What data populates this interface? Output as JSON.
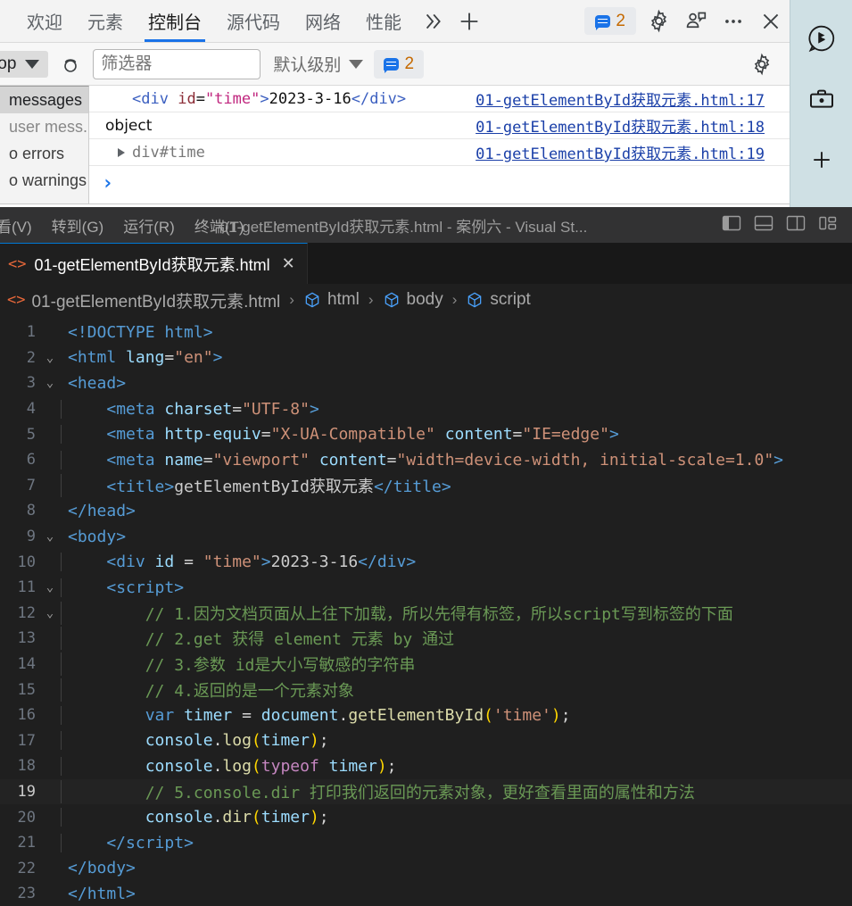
{
  "devtools": {
    "tabs": [
      {
        "label": "欢迎",
        "active": false
      },
      {
        "label": "元素",
        "active": false
      },
      {
        "label": "控制台",
        "active": true
      },
      {
        "label": "源代码",
        "active": false
      },
      {
        "label": "网络",
        "active": false
      },
      {
        "label": "性能",
        "active": false
      }
    ],
    "more_tabs_icon": "chevron-double-right-icon",
    "add_tab_icon": "plus-icon",
    "issues_count": "2",
    "settings_icon": "gear-icon",
    "customize_icon": "person-feedback-icon",
    "more_icon": "ellipsis-icon",
    "close_icon": "close-icon",
    "filterbar": {
      "context": "top",
      "clear_icon": "clear-console-icon",
      "filter_placeholder": "筛选器",
      "filter_value": "",
      "level": "默认级别",
      "issues_count": "2",
      "settings_icon": "gear-icon"
    },
    "sidebar": [
      {
        "label": "messages",
        "selected": true,
        "dim": false
      },
      {
        "label": "user mess...",
        "selected": false,
        "dim": true
      },
      {
        "label": "o errors",
        "selected": false,
        "dim": false
      },
      {
        "label": "o warnings",
        "selected": false,
        "dim": false
      }
    ],
    "logs": [
      {
        "kind": "html",
        "tag_open": "<div",
        "attr": "id",
        "eq": "=",
        "value": "\"time\"",
        "gt": ">",
        "text": "2023-3-16",
        "tag_close": "</div>",
        "source": "01-getElementById获取元素.html:17"
      },
      {
        "kind": "plain",
        "text": "object",
        "source": "01-getElementById获取元素.html:18"
      },
      {
        "kind": "object",
        "text": "div#time",
        "source": "01-getElementById获取元素.html:19"
      }
    ],
    "prompt_symbol": "›"
  },
  "edge_rail": {
    "items": [
      {
        "icon": "bing-copilot-icon"
      },
      {
        "icon": "briefcase-tools-icon"
      },
      {
        "icon": "plus-icon"
      }
    ]
  },
  "vscode": {
    "menus": [
      "看(V)",
      "转到(G)",
      "运行(R)",
      "终端(T)"
    ],
    "menu_overflow": "···",
    "window_title": "01-getElementById获取元素.html - 案例六 - Visual St...",
    "layout_buttons": [
      {
        "icon": "toggle-primary-sidebar-icon"
      },
      {
        "icon": "toggle-panel-icon"
      },
      {
        "icon": "toggle-secondary-sidebar-icon"
      },
      {
        "icon": "customize-layout-icon"
      }
    ],
    "tab": {
      "icon": "html-file-icon",
      "label": "01-getElementById获取元素.html",
      "close": "✕"
    },
    "breadcrumb": [
      {
        "icon": "html-file-icon",
        "label": "01-getElementById获取元素.html"
      },
      {
        "icon": "symbol-field-icon",
        "label": "html"
      },
      {
        "icon": "symbol-field-icon",
        "label": "body"
      },
      {
        "icon": "symbol-field-icon",
        "label": "script"
      }
    ],
    "breadcrumb_sep": "›",
    "code": [
      {
        "n": "1",
        "fold": "",
        "guide": false,
        "current": false,
        "tokens": [
          {
            "t": "<!DOCTYPE ",
            "c": "s-tag"
          },
          {
            "t": "html",
            "c": "s-name"
          },
          {
            "t": ">",
            "c": "s-tag"
          }
        ]
      },
      {
        "n": "2",
        "fold": "⌄",
        "guide": false,
        "current": false,
        "tokens": [
          {
            "t": "<",
            "c": "s-tag"
          },
          {
            "t": "html",
            "c": "s-name"
          },
          {
            "t": " ",
            "c": "s-txt"
          },
          {
            "t": "lang",
            "c": "s-attr"
          },
          {
            "t": "=",
            "c": "s-op"
          },
          {
            "t": "\"en\"",
            "c": "s-str"
          },
          {
            "t": ">",
            "c": "s-tag"
          }
        ]
      },
      {
        "n": "3",
        "fold": "⌄",
        "guide": false,
        "current": false,
        "tokens": [
          {
            "t": "<",
            "c": "s-tag"
          },
          {
            "t": "head",
            "c": "s-name"
          },
          {
            "t": ">",
            "c": "s-tag"
          }
        ]
      },
      {
        "n": "4",
        "fold": "",
        "guide": true,
        "current": false,
        "tokens": [
          {
            "t": "    <",
            "c": "s-tag"
          },
          {
            "t": "meta",
            "c": "s-name"
          },
          {
            "t": " ",
            "c": "s-txt"
          },
          {
            "t": "charset",
            "c": "s-attr"
          },
          {
            "t": "=",
            "c": "s-op"
          },
          {
            "t": "\"UTF-8\"",
            "c": "s-str"
          },
          {
            "t": ">",
            "c": "s-tag"
          }
        ]
      },
      {
        "n": "5",
        "fold": "",
        "guide": true,
        "current": false,
        "tokens": [
          {
            "t": "    <",
            "c": "s-tag"
          },
          {
            "t": "meta",
            "c": "s-name"
          },
          {
            "t": " ",
            "c": "s-txt"
          },
          {
            "t": "http-equiv",
            "c": "s-attr"
          },
          {
            "t": "=",
            "c": "s-op"
          },
          {
            "t": "\"X-UA-Compatible\"",
            "c": "s-str"
          },
          {
            "t": " ",
            "c": "s-txt"
          },
          {
            "t": "content",
            "c": "s-attr"
          },
          {
            "t": "=",
            "c": "s-op"
          },
          {
            "t": "\"IE=edge\"",
            "c": "s-str"
          },
          {
            "t": ">",
            "c": "s-tag"
          }
        ]
      },
      {
        "n": "6",
        "fold": "",
        "guide": true,
        "current": false,
        "tokens": [
          {
            "t": "    <",
            "c": "s-tag"
          },
          {
            "t": "meta",
            "c": "s-name"
          },
          {
            "t": " ",
            "c": "s-txt"
          },
          {
            "t": "name",
            "c": "s-attr"
          },
          {
            "t": "=",
            "c": "s-op"
          },
          {
            "t": "\"viewport\"",
            "c": "s-str"
          },
          {
            "t": " ",
            "c": "s-txt"
          },
          {
            "t": "content",
            "c": "s-attr"
          },
          {
            "t": "=",
            "c": "s-op"
          },
          {
            "t": "\"width=device-width, initial-scale=1.0\"",
            "c": "s-str"
          },
          {
            "t": ">",
            "c": "s-tag"
          }
        ]
      },
      {
        "n": "7",
        "fold": "",
        "guide": true,
        "current": false,
        "tokens": [
          {
            "t": "    <",
            "c": "s-tag"
          },
          {
            "t": "title",
            "c": "s-name"
          },
          {
            "t": ">",
            "c": "s-tag"
          },
          {
            "t": "getElementById获取元素",
            "c": "s-txt"
          },
          {
            "t": "</",
            "c": "s-tag"
          },
          {
            "t": "title",
            "c": "s-name"
          },
          {
            "t": ">",
            "c": "s-tag"
          }
        ]
      },
      {
        "n": "8",
        "fold": "",
        "guide": false,
        "current": false,
        "tokens": [
          {
            "t": "</",
            "c": "s-tag"
          },
          {
            "t": "head",
            "c": "s-name"
          },
          {
            "t": ">",
            "c": "s-tag"
          }
        ]
      },
      {
        "n": "9",
        "fold": "⌄",
        "guide": false,
        "current": false,
        "tokens": [
          {
            "t": "<",
            "c": "s-tag"
          },
          {
            "t": "body",
            "c": "s-name"
          },
          {
            "t": ">",
            "c": "s-tag"
          }
        ]
      },
      {
        "n": "10",
        "fold": "",
        "guide": true,
        "current": false,
        "tokens": [
          {
            "t": "    <",
            "c": "s-tag"
          },
          {
            "t": "div",
            "c": "s-name"
          },
          {
            "t": " ",
            "c": "s-txt"
          },
          {
            "t": "id",
            "c": "s-attr"
          },
          {
            "t": " = ",
            "c": "s-op"
          },
          {
            "t": "\"time\"",
            "c": "s-str"
          },
          {
            "t": ">",
            "c": "s-tag"
          },
          {
            "t": "2023-3-16",
            "c": "s-txt"
          },
          {
            "t": "</",
            "c": "s-tag"
          },
          {
            "t": "div",
            "c": "s-name"
          },
          {
            "t": ">",
            "c": "s-tag"
          }
        ]
      },
      {
        "n": "11",
        "fold": "⌄",
        "guide": true,
        "current": false,
        "tokens": [
          {
            "t": "    <",
            "c": "s-tag"
          },
          {
            "t": "script",
            "c": "s-name"
          },
          {
            "t": ">",
            "c": "s-tag"
          }
        ]
      },
      {
        "n": "12",
        "fold": "⌄",
        "guide": true,
        "current": false,
        "tokens": [
          {
            "t": "        // 1.因为文档页面从上往下加载，所以先得有标签，所以script写到标签的下面",
            "c": "s-cmt"
          }
        ]
      },
      {
        "n": "13",
        "fold": "",
        "guide": true,
        "current": false,
        "tokens": [
          {
            "t": "        // 2.get 获得 element 元素 by 通过",
            "c": "s-cmt"
          }
        ]
      },
      {
        "n": "14",
        "fold": "",
        "guide": true,
        "current": false,
        "tokens": [
          {
            "t": "        // 3.参数 id是大小写敏感的字符串",
            "c": "s-cmt"
          }
        ]
      },
      {
        "n": "15",
        "fold": "",
        "guide": true,
        "current": false,
        "tokens": [
          {
            "t": "        // 4.返回的是一个元素对象",
            "c": "s-cmt"
          }
        ]
      },
      {
        "n": "16",
        "fold": "",
        "guide": true,
        "current": false,
        "tokens": [
          {
            "t": "        ",
            "c": "s-txt"
          },
          {
            "t": "var",
            "c": "s-kw"
          },
          {
            "t": " ",
            "c": "s-txt"
          },
          {
            "t": "timer",
            "c": "s-var"
          },
          {
            "t": " = ",
            "c": "s-op"
          },
          {
            "t": "document",
            "c": "s-var"
          },
          {
            "t": ".",
            "c": "s-op"
          },
          {
            "t": "getElementById",
            "c": "s-fn"
          },
          {
            "t": "(",
            "c": "s-paren"
          },
          {
            "t": "'time'",
            "c": "s-str"
          },
          {
            "t": ")",
            "c": "s-paren"
          },
          {
            "t": ";",
            "c": "s-op"
          }
        ]
      },
      {
        "n": "17",
        "fold": "",
        "guide": true,
        "current": false,
        "tokens": [
          {
            "t": "        ",
            "c": "s-txt"
          },
          {
            "t": "console",
            "c": "s-var"
          },
          {
            "t": ".",
            "c": "s-op"
          },
          {
            "t": "log",
            "c": "s-fn"
          },
          {
            "t": "(",
            "c": "s-paren"
          },
          {
            "t": "timer",
            "c": "s-var"
          },
          {
            "t": ")",
            "c": "s-paren"
          },
          {
            "t": ";",
            "c": "s-op"
          }
        ]
      },
      {
        "n": "18",
        "fold": "",
        "guide": true,
        "current": false,
        "tokens": [
          {
            "t": "        ",
            "c": "s-txt"
          },
          {
            "t": "console",
            "c": "s-var"
          },
          {
            "t": ".",
            "c": "s-op"
          },
          {
            "t": "log",
            "c": "s-fn"
          },
          {
            "t": "(",
            "c": "s-paren"
          },
          {
            "t": "typeof",
            "c": "s-kw2"
          },
          {
            "t": " ",
            "c": "s-txt"
          },
          {
            "t": "timer",
            "c": "s-var"
          },
          {
            "t": ")",
            "c": "s-paren"
          },
          {
            "t": ";",
            "c": "s-op"
          }
        ]
      },
      {
        "n": "19",
        "fold": "",
        "guide": true,
        "current": true,
        "tokens": [
          {
            "t": "        // 5.console.dir 打印我们返回的元素对象，更好查看里面的属性和方法",
            "c": "s-cmt"
          }
        ]
      },
      {
        "n": "20",
        "fold": "",
        "guide": true,
        "current": false,
        "tokens": [
          {
            "t": "        ",
            "c": "s-txt"
          },
          {
            "t": "console",
            "c": "s-var"
          },
          {
            "t": ".",
            "c": "s-op"
          },
          {
            "t": "dir",
            "c": "s-fn"
          },
          {
            "t": "(",
            "c": "s-paren"
          },
          {
            "t": "timer",
            "c": "s-var"
          },
          {
            "t": ")",
            "c": "s-paren"
          },
          {
            "t": ";",
            "c": "s-op"
          }
        ]
      },
      {
        "n": "21",
        "fold": "",
        "guide": true,
        "current": false,
        "tokens": [
          {
            "t": "    </",
            "c": "s-tag"
          },
          {
            "t": "script",
            "c": "s-name"
          },
          {
            "t": ">",
            "c": "s-tag"
          }
        ]
      },
      {
        "n": "22",
        "fold": "",
        "guide": false,
        "current": false,
        "tokens": [
          {
            "t": "</",
            "c": "s-tag"
          },
          {
            "t": "body",
            "c": "s-name"
          },
          {
            "t": ">",
            "c": "s-tag"
          }
        ]
      },
      {
        "n": "23",
        "fold": "",
        "guide": false,
        "current": false,
        "tokens": [
          {
            "t": "</",
            "c": "s-tag"
          },
          {
            "t": "html",
            "c": "s-name"
          },
          {
            "t": ">",
            "c": "s-tag"
          }
        ]
      }
    ]
  },
  "colors": {
    "devtools_bg": "#ffffff",
    "devtools_toolbar": "#f3f3f3",
    "accent_blue": "#1a73e8",
    "vscode_bg": "#1f1f1f",
    "vscode_titlebar": "#323233",
    "vscode_tabbar": "#181818",
    "tab_active_border": "#0078d4",
    "edge_rail_bg": "#cfe0e4"
  }
}
